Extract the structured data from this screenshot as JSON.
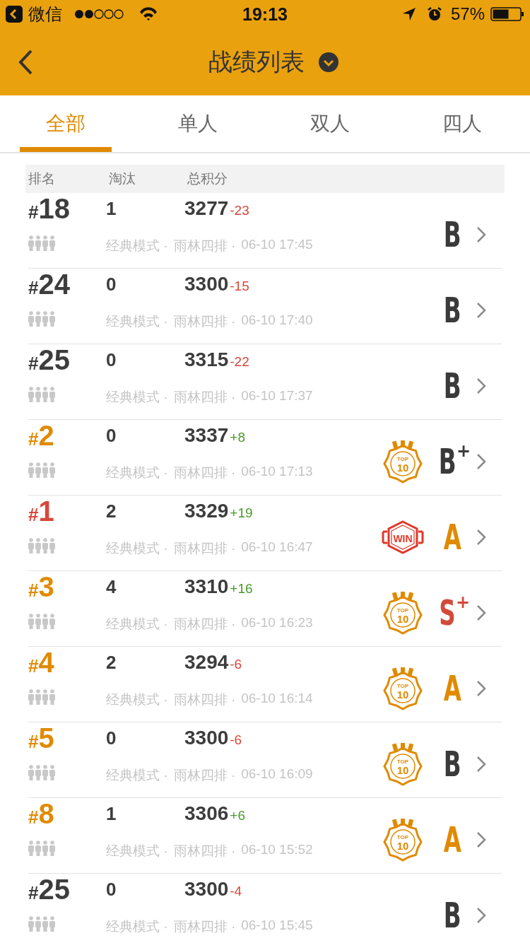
{
  "status_bar": {
    "back_app": "微信",
    "time": "19:13",
    "battery": "57%"
  },
  "nav": {
    "title": "战绩列表"
  },
  "tabs": [
    {
      "label": "全部",
      "selected": true
    },
    {
      "label": "单人",
      "selected": false
    },
    {
      "label": "双人",
      "selected": false
    },
    {
      "label": "四人",
      "selected": false
    }
  ],
  "table": {
    "columns": [
      "排名",
      "淘汰",
      "总积分"
    ],
    "rows": [
      {
        "rank": {
          "mark": "#",
          "number": "18",
          "color": "#3d3d3d"
        },
        "kills": "1",
        "score": "3277",
        "change": {
          "text": "-23",
          "color": "#d9473a"
        },
        "mode": "经典模式 ·",
        "map": "雨林四排 ·",
        "time": "06-10 17:45",
        "grade": {
          "letter": "B",
          "color": "#3a3a3a"
        }
      },
      {
        "rank": {
          "mark": "#",
          "number": "24",
          "color": "#3d3d3d"
        },
        "kills": "0",
        "score": "3300",
        "change": {
          "text": "-15",
          "color": "#d9473a"
        },
        "mode": "经典模式 ·",
        "map": "雨林四排 ·",
        "time": "06-10 17:40",
        "grade": {
          "letter": "B",
          "color": "#3a3a3a"
        }
      },
      {
        "rank": {
          "mark": "#",
          "number": "25",
          "color": "#3d3d3d"
        },
        "kills": "0",
        "score": "3315",
        "change": {
          "text": "-22",
          "color": "#d9473a"
        },
        "mode": "经典模式 ·",
        "map": "雨林四排 ·",
        "time": "06-10 17:37",
        "grade": {
          "letter": "B",
          "color": "#3a3a3a"
        }
      },
      {
        "rank": {
          "mark": "#",
          "number": "2",
          "color": "#e08a00"
        },
        "kills": "0",
        "score": "3337",
        "change": {
          "text": "+8",
          "color": "#4a9a2a"
        },
        "mode": "经典模式 ·",
        "map": "雨林四排 ·",
        "time": "06-10 17:13",
        "badge": {
          "kind": "top",
          "top": "TOP",
          "main": "10"
        },
        "grade": {
          "letter": "B",
          "plus": "+",
          "color": "#3a3a3a"
        }
      },
      {
        "rank": {
          "mark": "#",
          "number": "1",
          "color": "#d9473a"
        },
        "kills": "2",
        "score": "3329",
        "change": {
          "text": "+19",
          "color": "#4a9a2a"
        },
        "mode": "经典模式 ·",
        "map": "雨林四排 ·",
        "time": "06-10 16:47",
        "badge": {
          "kind": "win",
          "main": "WIN"
        },
        "grade": {
          "letter": "A",
          "color": "#e08a00"
        }
      },
      {
        "rank": {
          "mark": "#",
          "number": "3",
          "color": "#e08a00"
        },
        "kills": "4",
        "score": "3310",
        "change": {
          "text": "+16",
          "color": "#4a9a2a"
        },
        "mode": "经典模式 ·",
        "map": "雨林四排 ·",
        "time": "06-10 16:23",
        "badge": {
          "kind": "top",
          "top": "TOP",
          "main": "10"
        },
        "grade": {
          "letter": "S",
          "plus": "+",
          "color": "#d24a3a"
        }
      },
      {
        "rank": {
          "mark": "#",
          "number": "4",
          "color": "#e08a00"
        },
        "kills": "2",
        "score": "3294",
        "change": {
          "text": "-6",
          "color": "#d9473a"
        },
        "mode": "经典模式 ·",
        "map": "雨林四排 ·",
        "time": "06-10 16:14",
        "badge": {
          "kind": "top",
          "top": "TOP",
          "main": "10"
        },
        "grade": {
          "letter": "A",
          "color": "#e08a00"
        }
      },
      {
        "rank": {
          "mark": "#",
          "number": "5",
          "color": "#e08a00"
        },
        "kills": "0",
        "score": "3300",
        "change": {
          "text": "-6",
          "color": "#d9473a"
        },
        "mode": "经典模式 ·",
        "map": "雨林四排 ·",
        "time": "06-10 16:09",
        "badge": {
          "kind": "top",
          "top": "TOP",
          "main": "10"
        },
        "grade": {
          "letter": "B",
          "color": "#3a3a3a"
        }
      },
      {
        "rank": {
          "mark": "#",
          "number": "8",
          "color": "#e08a00"
        },
        "kills": "1",
        "score": "3306",
        "change": {
          "text": "+6",
          "color": "#4a9a2a"
        },
        "mode": "经典模式 ·",
        "map": "雨林四排 ·",
        "time": "06-10 15:52",
        "badge": {
          "kind": "top",
          "top": "TOP",
          "main": "10"
        },
        "grade": {
          "letter": "A",
          "color": "#e08a00"
        }
      },
      {
        "rank": {
          "mark": "#",
          "number": "25",
          "color": "#3d3d3d"
        },
        "kills": "0",
        "score": "3300",
        "change": {
          "text": "-4",
          "color": "#d9473a"
        },
        "mode": "经典模式 ·",
        "map": "雨林四排 ·",
        "time": "06-10 15:45",
        "grade": {
          "letter": "B",
          "color": "#3a3a3a"
        }
      }
    ]
  }
}
